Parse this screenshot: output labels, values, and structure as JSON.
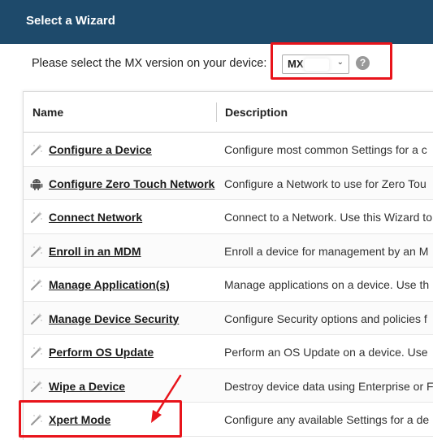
{
  "header": {
    "title": "Select a Wizard"
  },
  "version": {
    "label": "Please select the MX version on your device:",
    "selected": "MX",
    "help_icon": "question-circle-icon"
  },
  "table": {
    "columns": [
      "Name",
      "Description"
    ],
    "rows": [
      {
        "icon": "wand-icon",
        "name": "Configure a Device",
        "description": "Configure most common Settings for a c"
      },
      {
        "icon": "android-icon",
        "name": "Configure Zero Touch Network",
        "description": "Configure a Network to use for Zero Tou"
      },
      {
        "icon": "wand-icon",
        "name": "Connect Network",
        "description": "Connect to a Network. Use this Wizard to"
      },
      {
        "icon": "wand-icon",
        "name": "Enroll in an MDM",
        "description": "Enroll a device for management by an M"
      },
      {
        "icon": "wand-icon",
        "name": "Manage Application(s)",
        "description": "Manage applications on a device.  Use th"
      },
      {
        "icon": "wand-icon",
        "name": "Manage Device Security",
        "description": "Configure Security options and policies f"
      },
      {
        "icon": "wand-icon",
        "name": "Perform OS Update",
        "description": "Perform an OS Update on a device.  Use"
      },
      {
        "icon": "wand-icon",
        "name": "Wipe a Device",
        "description": "Destroy device data using Enterprise or F"
      },
      {
        "icon": "wand-icon",
        "name": "Xpert Mode",
        "description": "Configure any available Settings for a de"
      }
    ]
  },
  "colors": {
    "header_bg": "#1e4a6b",
    "highlight": "#e8141b"
  }
}
